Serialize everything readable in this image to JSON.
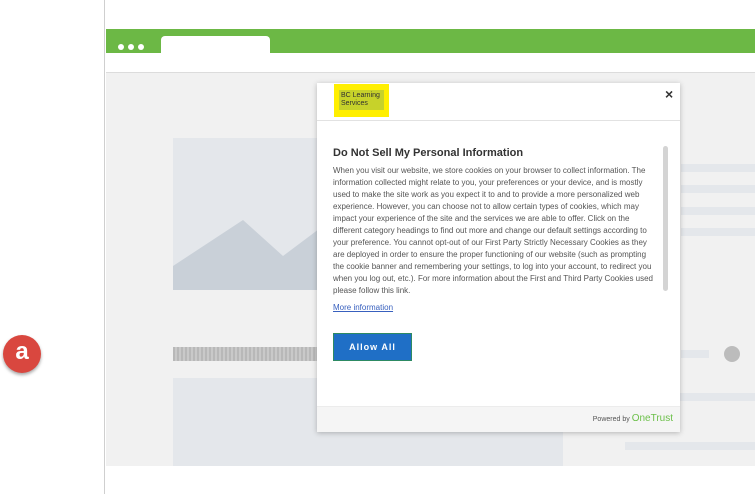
{
  "annotation": {
    "badge_label": "a"
  },
  "modal": {
    "logo_text": "BC Learning Services",
    "close_label": "×",
    "title": "Do Not Sell My Personal Information",
    "description": "When you visit our website, we store cookies on your browser to collect information. The information collected might relate to you, your preferences or your device, and is mostly used to make the site work as you expect it to and to provide a more personalized web experience. However, you can choose not to allow certain types of cookies, which may impact your experience of the site and the services we are able to offer. Click on the different category headings to find out more and change our default settings according to your preference. You cannot opt-out of our First Party Strictly Necessary Cookies as they are deployed in order to ensure the proper functioning of our website (such as prompting the cookie banner and remembering your settings, to log into your account, to redirect you when you log out, etc.). For more information about the First and Third Party Cookies used please follow this link.",
    "more_info_link": "More information",
    "allow_button": "Allow All",
    "powered_prefix": "Powered by",
    "powered_brand": "OneTrust"
  },
  "colors": {
    "browser_bar": "#6cb845",
    "badge": "#d9473f",
    "allow_button": "#1f6fc6",
    "logo_bg": "#ffef00",
    "link": "#3860be",
    "onetrust_brand": "#6cc04a"
  }
}
